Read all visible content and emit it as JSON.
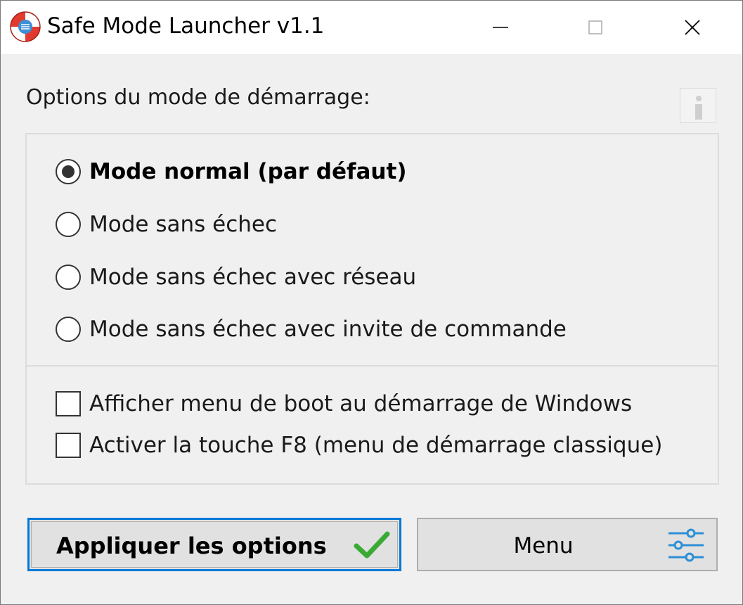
{
  "window": {
    "title": "Safe Mode Launcher v1.1",
    "icon": "lifebuoy-icon"
  },
  "titlebar_controls": [
    "minimize-icon",
    "maximize-icon",
    "close-icon"
  ],
  "boot_options": {
    "label": "Options du mode de démarrage:",
    "info_icon": "info-icon",
    "modes": [
      {
        "label": "Mode normal (par défaut)",
        "checked": true
      },
      {
        "label": "Mode sans échec",
        "checked": false
      },
      {
        "label": "Mode sans échec avec réseau",
        "checked": false
      },
      {
        "label": "Mode sans échec avec invite de commande",
        "checked": false
      }
    ],
    "checkboxes": [
      {
        "label": "Afficher menu de boot au démarrage de Windows",
        "checked": false
      },
      {
        "label": "Activer la touche F8 (menu de démarrage classique)",
        "checked": false
      }
    ]
  },
  "buttons": {
    "apply_label": "Appliquer les options",
    "apply_icon": "checkmark-icon",
    "menu_label": "Menu",
    "menu_icon": "sliders-icon"
  },
  "colors": {
    "accent": "#0078d7",
    "check_green": "#3aaa35",
    "sliders_blue": "#2b8fd6"
  }
}
